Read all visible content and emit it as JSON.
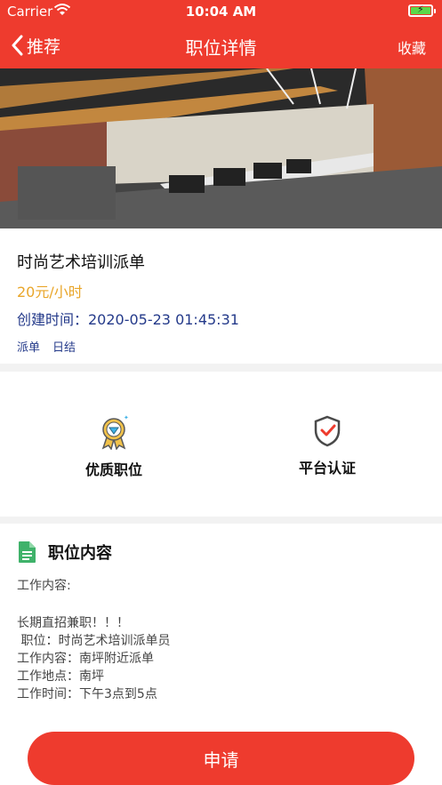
{
  "status_bar": {
    "carrier": "Carrier",
    "time": "10:04 AM"
  },
  "nav": {
    "back_label": "推荐",
    "title": "职位详情",
    "favorite_label": "收藏"
  },
  "job": {
    "title": "时尚艺术培训派单",
    "salary": "20元/小时",
    "created": "创建时间：2020-05-23 01:45:31",
    "tags": [
      "派单",
      "日结"
    ]
  },
  "features": [
    {
      "label": "优质职位",
      "icon": "quality-badge-icon"
    },
    {
      "label": "平台认证",
      "icon": "shield-check-icon"
    }
  ],
  "section": {
    "title": "职位内容",
    "icon": "document-icon",
    "lines": [
      "工作内容:",
      "",
      "长期直招兼职！！！",
      " 职位：时尚艺术培训派单员",
      "工作内容：南坪附近派单",
      "工作地点：南坪",
      "工作时间：下午3点到5点"
    ]
  },
  "apply_label": "申请",
  "colors": {
    "accent": "#ee3b2e",
    "salary": "#e9a62a",
    "meta": "#243a8a",
    "icon_green": "#3fb26a"
  }
}
